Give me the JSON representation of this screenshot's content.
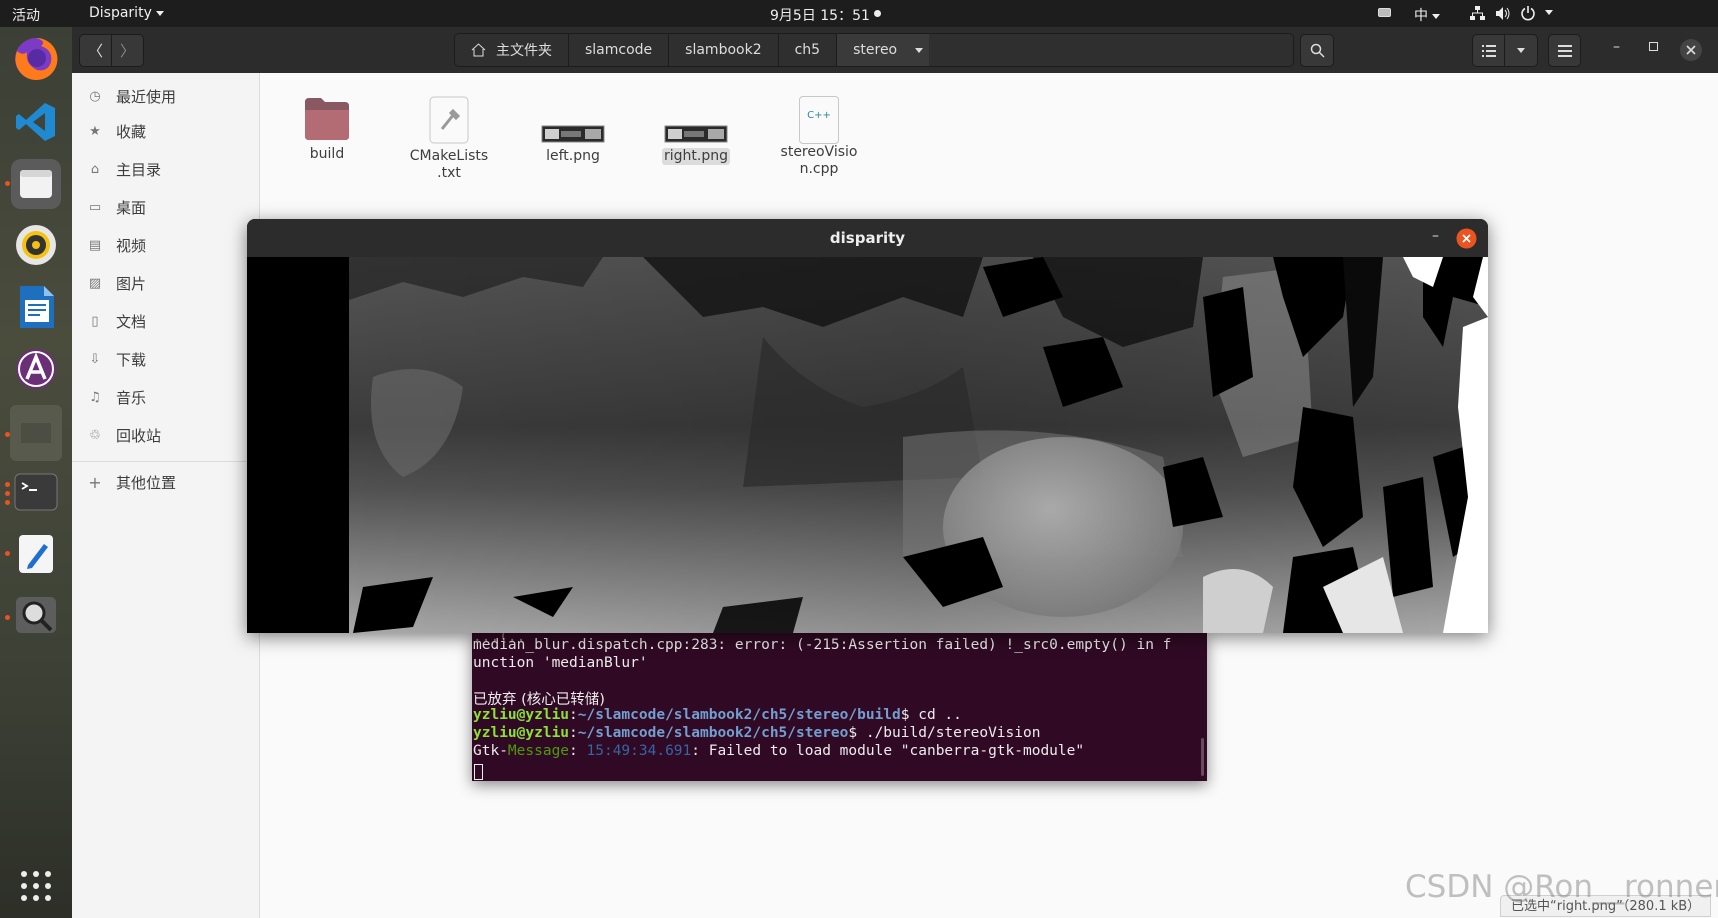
{
  "topbar": {
    "activities": "活动",
    "app_menu": "Disparity",
    "clock": "9月5日 15：51",
    "input_method": "中"
  },
  "dock": {
    "apps": [
      "firefox-icon",
      "vscode-icon",
      "files-icon",
      "rhythmbox-icon",
      "libreoffice-writer-icon",
      "software-center-icon",
      "disparity-window-icon",
      "terminal-icon",
      "text-editor-icon",
      "image-viewer-icon"
    ]
  },
  "files_window": {
    "breadcrumbs": [
      "主文件夹",
      "slamcode",
      "slambook2",
      "ch5",
      "stereo"
    ],
    "sidebar": {
      "items": [
        {
          "icon": "clock-icon",
          "label": "最近使用"
        },
        {
          "icon": "star-icon",
          "label": "收藏"
        },
        {
          "icon": "home-icon",
          "label": "主目录"
        },
        {
          "icon": "desktop-icon",
          "label": "桌面"
        },
        {
          "icon": "video-icon",
          "label": "视频"
        },
        {
          "icon": "picture-icon",
          "label": "图片"
        },
        {
          "icon": "document-icon",
          "label": "文档"
        },
        {
          "icon": "download-icon",
          "label": "下载"
        },
        {
          "icon": "music-icon",
          "label": "音乐"
        },
        {
          "icon": "trash-icon",
          "label": "回收站"
        }
      ],
      "other_locations": "其他位置"
    },
    "files": [
      {
        "name": "build",
        "type": "folder"
      },
      {
        "name": "CMakeLists.txt",
        "line1": "CMakeLists",
        "line2": ".txt",
        "type": "text"
      },
      {
        "name": "left.png",
        "type": "image"
      },
      {
        "name": "right.png",
        "type": "image",
        "selected": true
      },
      {
        "name": "stereoVision.cpp",
        "line1": "stereoVisio",
        "line2": "n.cpp",
        "type": "cpp",
        "badge": "C++"
      }
    ],
    "status": "已选中“right.png”（280.1 kB）"
  },
  "disparity_window": {
    "title": "disparity"
  },
  "terminal": {
    "lines": [
      {
        "text": "median_blur.dispatch.cpp:283: error: (-215:Assertion failed) !_src0.empty() in f"
      },
      {
        "text": "unction 'medianBlur'"
      },
      {
        "text": "已放弃 (核心已转储)"
      },
      {
        "user": "yzliu@yzliu",
        "path": "~/slamcode/slambook2/ch5/stereo/build",
        "cmd": "$ cd .."
      },
      {
        "user": "yzliu@yzliu",
        "path": "~/slamcode/slambook2/ch5/stereo",
        "cmd": "$ ./build/stereoVision"
      },
      {
        "gtk": "Gtk-",
        "msg": "Message",
        "time": "15:49:34.691",
        "rest": ": Failed to load module \"canberra-gtk-module\""
      }
    ]
  },
  "watermark": "CSDN @Ron__ronner"
}
